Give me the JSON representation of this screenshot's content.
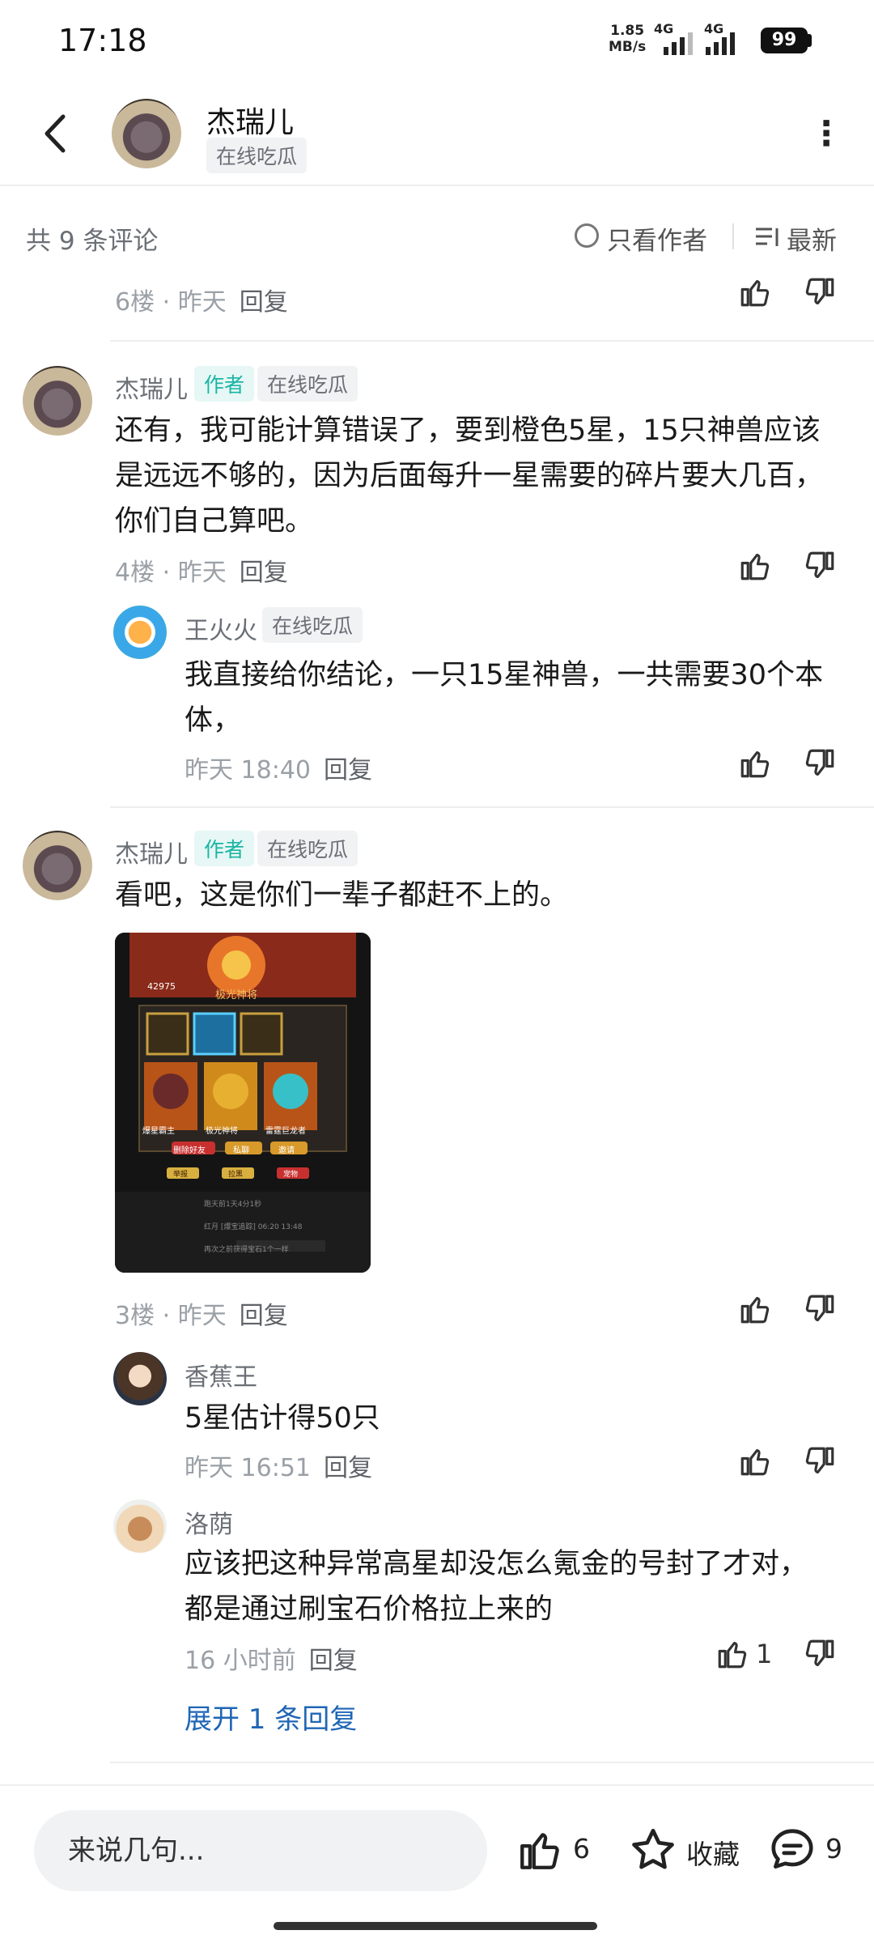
{
  "status": {
    "time": "17:18",
    "speed": "1.85",
    "speed_unit": "MB/s",
    "net1": "4G",
    "net2": "4G",
    "battery": "99"
  },
  "header": {
    "name": "杰瑞儿",
    "tag": "在线吃瓜",
    "more": "⋮"
  },
  "sort": {
    "count": "共 9 条评论",
    "only_author": "只看作者",
    "latest": "最新"
  },
  "floor6": {
    "meta": "6楼 · 昨天",
    "reply": "回复"
  },
  "floor4": {
    "name": "杰瑞儿",
    "author_tag": "作者",
    "tag": "在线吃瓜",
    "text": "还有，我可能计算错误了，要到橙色5星，15只神兽应该是远远不够的，因为后面每升一星需要的碎片要大几百，你们自己算吧。",
    "meta": "4楼 · 昨天",
    "reply": "回复",
    "sub": {
      "name": "王火火",
      "tag": "在线吃瓜",
      "text": "我直接给你结论，一只15星神兽，一共需要30个本体，",
      "meta": "昨天 18:40",
      "reply": "回复"
    }
  },
  "floor3": {
    "name": "杰瑞儿",
    "author_tag": "作者",
    "tag": "在线吃瓜",
    "text": "看吧，这是你们一辈子都赶不上的。",
    "meta": "3楼 · 昨天",
    "reply": "回复",
    "image": {
      "title": "极光神将",
      "score": "42975",
      "buttons": [
        "删除好友",
        "私聊",
        "邀请"
      ],
      "buttons2": [
        "举报",
        "拉黑",
        "宠物"
      ],
      "cards": [
        "爆星霸主",
        "极光神将",
        "雷霆巨龙者"
      ],
      "feed": [
        "跑天前1天4分1秒",
        "红月 [爆宝追踪] 06:20 13:48",
        "再次之前获得宝石1个一样"
      ]
    },
    "sub1": {
      "name": "香蕉王",
      "text": "5星估计得50只",
      "meta": "昨天 16:51",
      "reply": "回复"
    },
    "sub2": {
      "name": "洛荫",
      "text": "应该把这种异常高星却没怎么氪金的号封了才对，都是通过刷宝石价格拉上来的",
      "meta": "16 小时前",
      "reply": "回复",
      "likes": "1"
    },
    "expand": "展开 1 条回复"
  },
  "bottom": {
    "placeholder": "来说几句...",
    "likes": "6",
    "favorite": "收藏",
    "comments": "9"
  }
}
